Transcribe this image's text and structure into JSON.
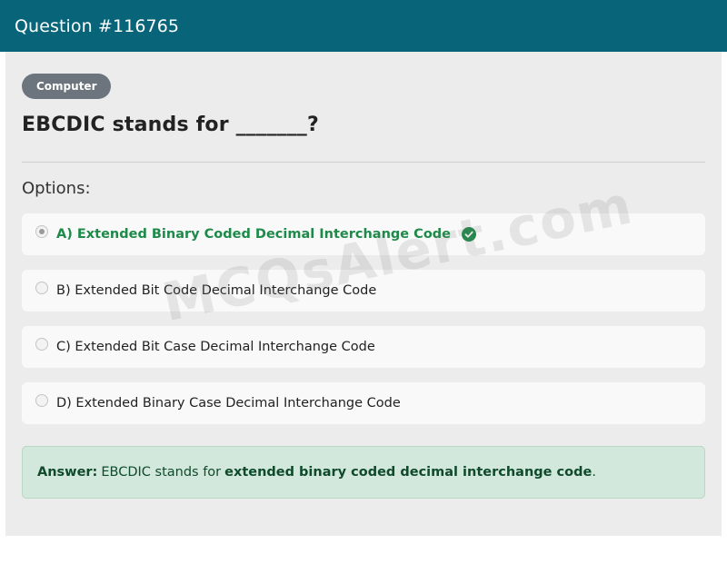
{
  "header": {
    "title": "Question #116765"
  },
  "question": {
    "category": "Computer",
    "text": "EBCDIC stands for _______?",
    "options_label": "Options:",
    "options": [
      {
        "label": "A) Extended Binary Coded Decimal Interchange Code",
        "selected": true,
        "correct": true
      },
      {
        "label": "B) Extended Bit Code Decimal Interchange Code",
        "selected": false,
        "correct": false
      },
      {
        "label": "C) Extended Bit Case Decimal Interchange Code",
        "selected": false,
        "correct": false
      },
      {
        "label": "D) Extended Binary Case Decimal Interchange Code",
        "selected": false,
        "correct": false
      }
    ]
  },
  "answer": {
    "label": "Answer:",
    "prefix": "EBCDIC stands for",
    "highlight": "extended binary coded decimal interchange code",
    "suffix": "."
  },
  "watermark": {
    "text": "MCQsAlert.com"
  },
  "colors": {
    "header": "#086579",
    "correct": "#1e8a49",
    "answer_bg": "#d2e8dc"
  },
  "icons": {
    "correct": "check-circle-icon"
  }
}
